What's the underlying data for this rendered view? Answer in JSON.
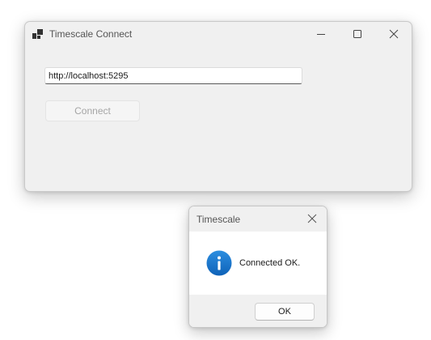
{
  "main_window": {
    "title": "Timescale Connect",
    "title_icon": "app-window-icon",
    "caption_buttons": {
      "minimize_icon": "minimize-icon",
      "maximize_icon": "maximize-icon",
      "close_icon": "close-icon"
    },
    "url_input": {
      "value": "http://localhost:5295",
      "placeholder": ""
    },
    "connect_button": {
      "label": "Connect",
      "state": "disabled"
    }
  },
  "message_box": {
    "title": "Timescale",
    "close_icon": "close-icon",
    "icon": "info-icon",
    "message": "Connected OK.",
    "ok_button": {
      "label": "OK"
    }
  },
  "colors": {
    "window_background": "#f0f0f0",
    "info_blue": "#1a73c9",
    "disabled_text": "#a5a5a5",
    "title_text": "#555555"
  }
}
